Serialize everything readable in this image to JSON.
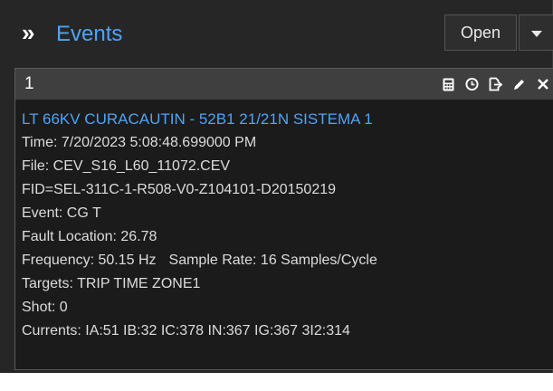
{
  "header": {
    "title": "Events",
    "open_label": "Open"
  },
  "icons": {
    "expand": "double-chevron-right-icon",
    "dropdown": "caret-down-icon",
    "calculator": "calculator-icon",
    "clock": "clock-icon",
    "export": "export-icon",
    "edit": "pencil-icon",
    "close": "close-icon"
  },
  "colors": {
    "accent": "#4fa3f7",
    "background": "#262626",
    "panel_header": "#3f3f3f",
    "panel_body": "#1b1b1b"
  },
  "event": {
    "id": "1",
    "name": "LT 66KV CURACAUTIN - 52B1 21/21N SISTEMA 1",
    "time": "Time:  7/20/2023 5:08:48.699000 PM",
    "file": "File: CEV_S16_L60_11072.CEV",
    "fid": "FID=SEL-311C-1-R508-V0-Z104101-D20150219",
    "event_type": "Event: CG T",
    "fault_location": "Fault Location: 26.78",
    "frequency": "Frequency: 50.15 Hz",
    "sample_rate": "Sample Rate: 16 Samples/Cycle",
    "targets": "Targets: TRIP TIME ZONE1",
    "shot": "Shot: 0",
    "currents": "Currents: IA:51 IB:32 IC:378 IN:367 IG:367 3I2:314"
  }
}
